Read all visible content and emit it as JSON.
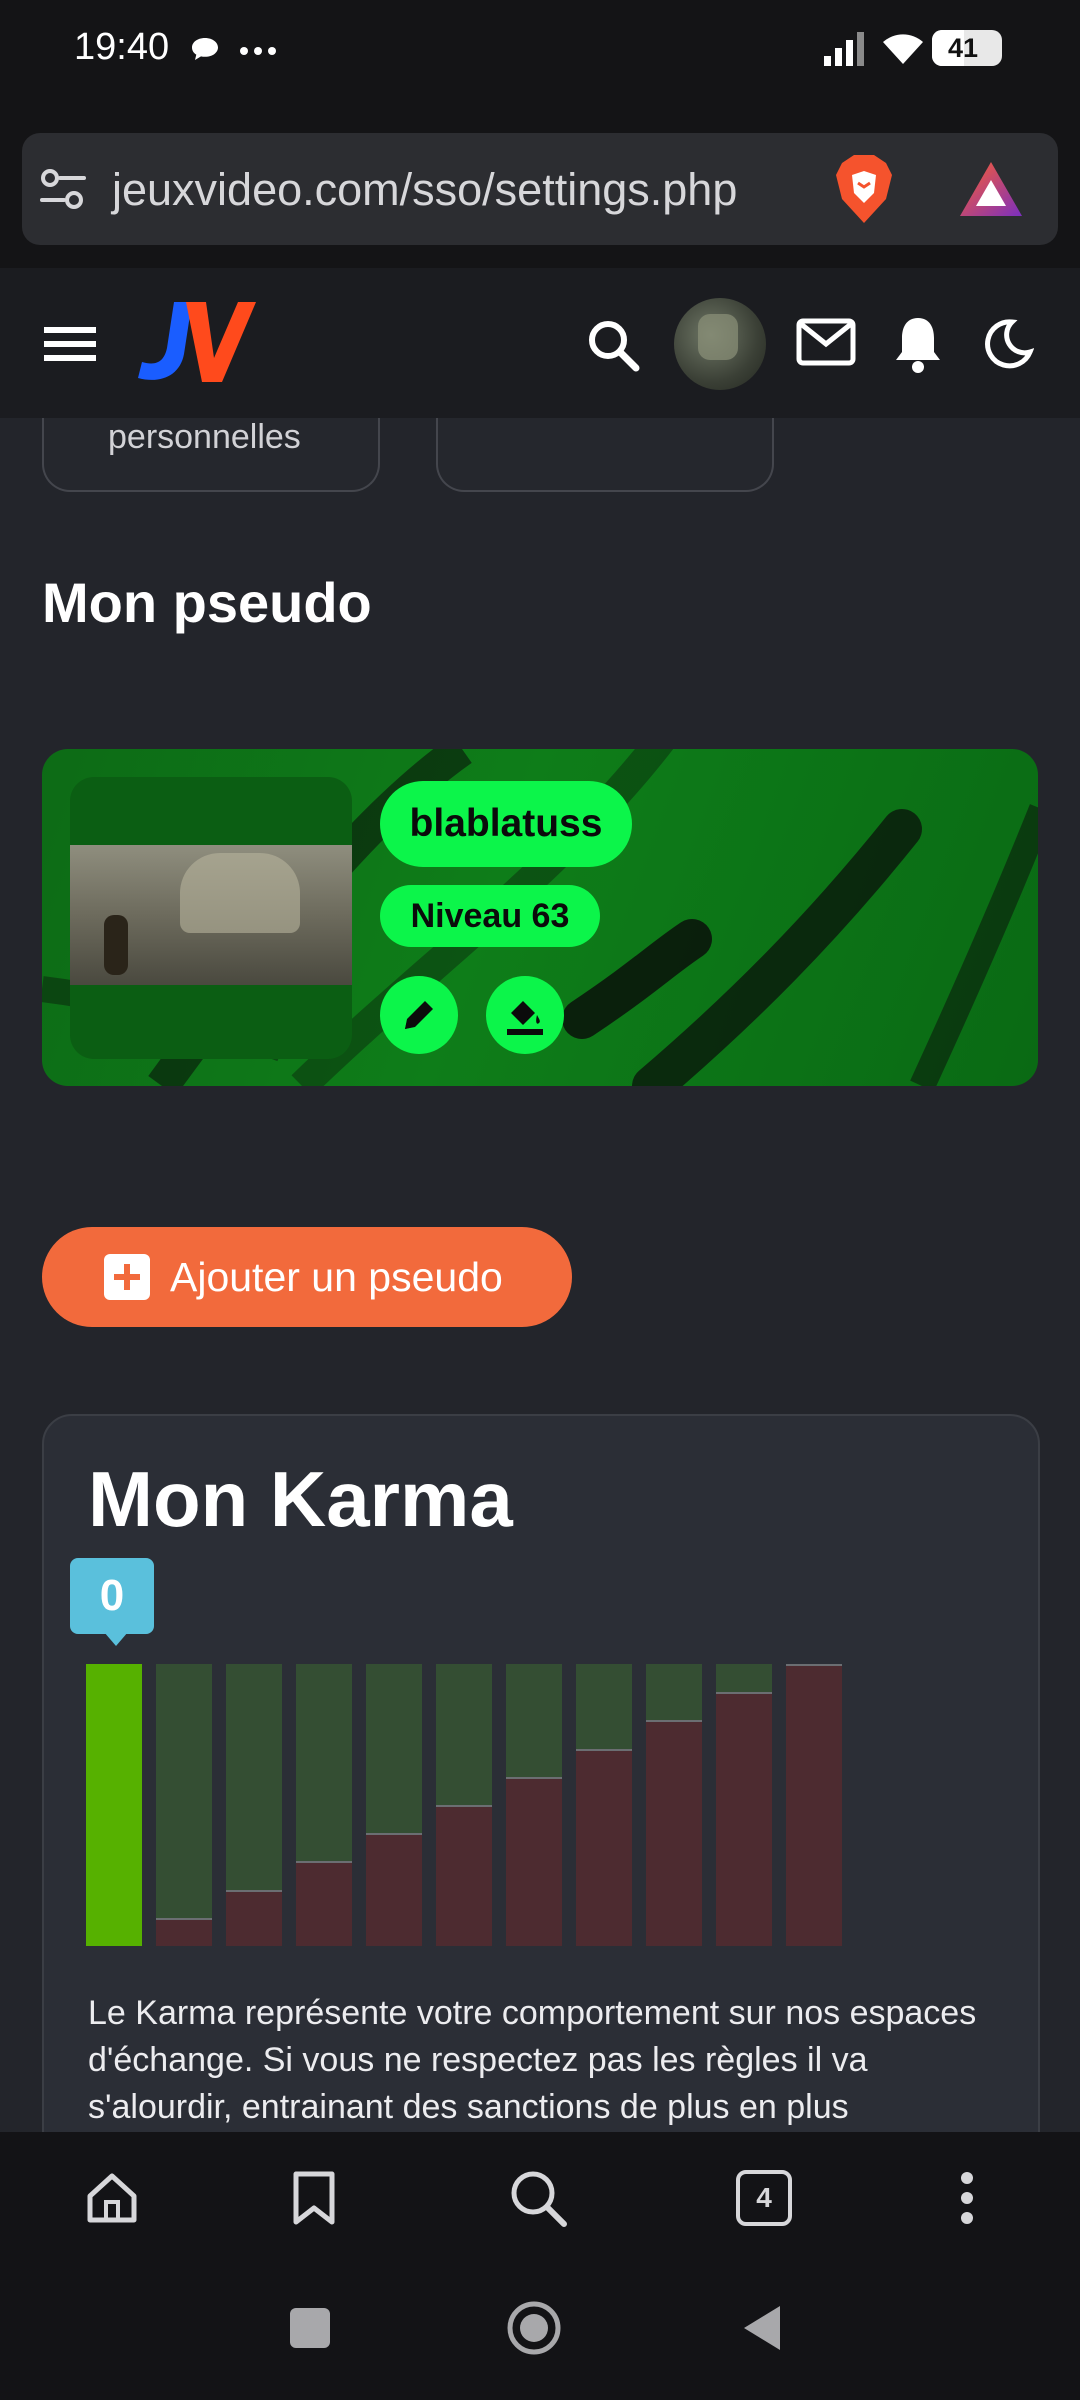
{
  "status_bar": {
    "time": "19:40",
    "battery": "41"
  },
  "browser": {
    "url": "jeuxvideo.com/sso/settings.php",
    "tabs_count": "4"
  },
  "site": {
    "logo_text": "JV"
  },
  "tabs": {
    "tab1_label": "personnelles",
    "tab2_label": ""
  },
  "pseudo_section": {
    "title": "Mon pseudo",
    "username": "blablatuss",
    "level": "Niveau 63",
    "add_button": "Ajouter un pseudo"
  },
  "karma": {
    "title": "Mon Karma",
    "value": "0",
    "description": "Le Karma représente votre comportement sur nos espaces d'échange. Si vous ne respectez pas les règles il va s'alourdir, entrainant des sanctions de plus en plus",
    "colors": {
      "active": "#56b100",
      "positive": "#344e33",
      "negative": "#4d2b30"
    },
    "bars": [
      {
        "negative": 0.0,
        "active": true
      },
      {
        "negative": 0.1
      },
      {
        "negative": 0.2
      },
      {
        "negative": 0.3
      },
      {
        "negative": 0.4
      },
      {
        "negative": 0.5
      },
      {
        "negative": 0.6
      },
      {
        "negative": 0.7
      },
      {
        "negative": 0.8
      },
      {
        "negative": 0.9
      },
      {
        "negative": 1.0
      }
    ]
  },
  "colors": {
    "accent_green": "#0cf54a",
    "accent_orange": "#f26a3c"
  }
}
